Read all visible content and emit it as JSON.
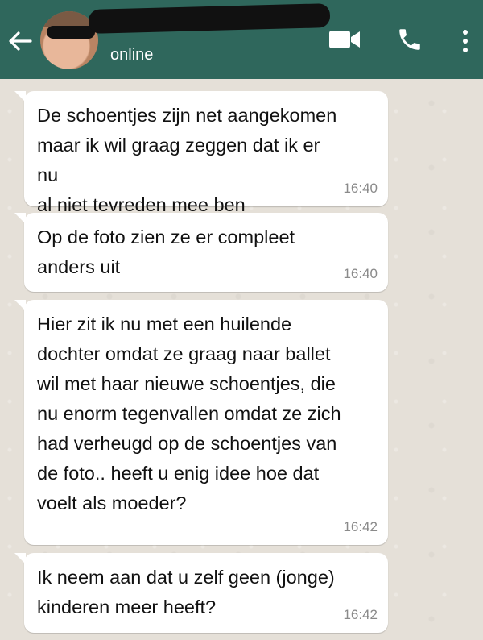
{
  "header": {
    "status": "online",
    "colors": {
      "bar": "#2f675c",
      "text": "#ffffff"
    },
    "icons": [
      "back-arrow-icon",
      "video-call-icon",
      "phone-icon",
      "more-menu-icon"
    ]
  },
  "messages": [
    {
      "text": "De schoentjes zijn net aangekomen\nmaar ik wil graag zeggen dat ik er nu\nal niet tevreden mee ben",
      "time": "16:40"
    },
    {
      "text": "Op de foto zien ze er compleet\nanders uit",
      "time": "16:40"
    },
    {
      "text": "Hier zit ik nu met een huilende\ndochter omdat ze graag naar ballet\nwil met haar nieuwe schoentjes, die\nnu enorm tegenvallen omdat ze zich\nhad verheugd op de schoentjes van\nde foto.. heeft u enig idee hoe dat\nvoelt als moeder?",
      "time": "16:42"
    },
    {
      "text": "Ik neem aan dat u zelf geen (jonge)\nkinderen meer heeft?",
      "time": "16:42"
    }
  ]
}
